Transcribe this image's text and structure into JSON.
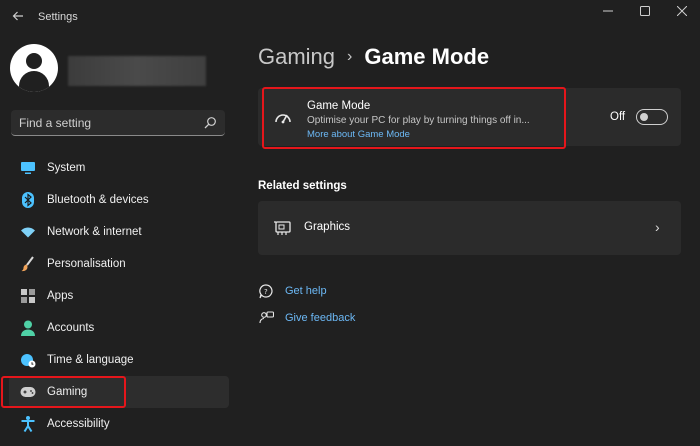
{
  "window": {
    "title": "Settings",
    "controls": [
      "minimize",
      "maximize",
      "close"
    ]
  },
  "sidebar": {
    "search": {
      "placeholder": "Find a setting"
    },
    "items": [
      {
        "label": "System",
        "icon": "display-icon",
        "color": "#4cc2ff"
      },
      {
        "label": "Bluetooth & devices",
        "icon": "bluetooth-icon",
        "color": "#4cc2ff"
      },
      {
        "label": "Network & internet",
        "icon": "wifi-icon",
        "color": "#7fd1f7"
      },
      {
        "label": "Personalisation",
        "icon": "brush-icon",
        "color": "#f0a35a"
      },
      {
        "label": "Apps",
        "icon": "apps-icon",
        "color": "#c8c8c8"
      },
      {
        "label": "Accounts",
        "icon": "person-icon",
        "color": "#4fd1a6"
      },
      {
        "label": "Time & language",
        "icon": "globe-clock-icon",
        "color": "#4cc2ff"
      },
      {
        "label": "Gaming",
        "icon": "gamepad-icon",
        "color": "#cfcfcf",
        "selected": true
      },
      {
        "label": "Accessibility",
        "icon": "accessibility-icon",
        "color": "#4cc2ff"
      }
    ]
  },
  "breadcrumb": {
    "parent": "Gaming",
    "current": "Game Mode"
  },
  "game_mode": {
    "title": "Game Mode",
    "description": "Optimise your PC for play by turning things off in...",
    "link": "More about Game Mode",
    "state_label": "Off",
    "enabled": false
  },
  "related": {
    "heading": "Related settings",
    "items": [
      {
        "label": "Graphics",
        "icon": "graphics-card-icon"
      }
    ]
  },
  "help": {
    "get_help": "Get help",
    "give_feedback": "Give feedback"
  },
  "colors": {
    "background": "#202020",
    "card": "#2b2b2b",
    "accent_link": "#6cb8f5",
    "highlight_red": "#e5161b"
  }
}
